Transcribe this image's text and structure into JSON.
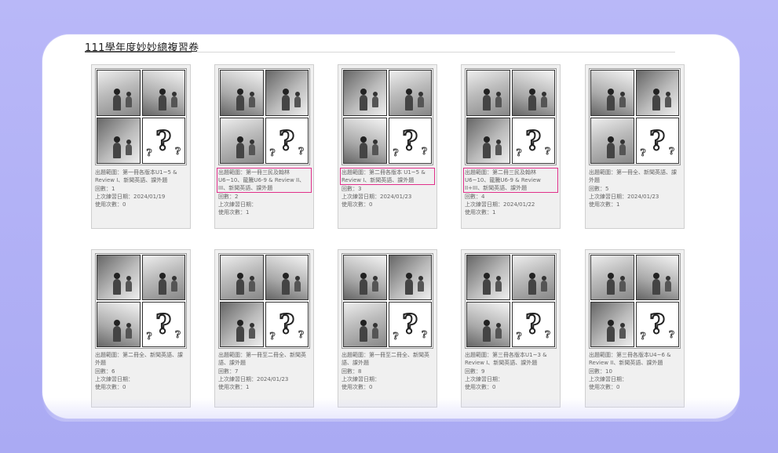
{
  "page": {
    "title": "111學年度妙妙總複習卷"
  },
  "labels": {
    "range": "出題範圍：",
    "count": "回數：",
    "last": "上次練習日期：",
    "uses": "使用次數："
  },
  "cards": [
    {
      "range": "第一冊各版本U1~5 & Review I、新聞英語、課外題",
      "count": "1",
      "last": "2024/01/19",
      "uses": "0",
      "highlighted": false
    },
    {
      "range": "第一冊三民及翰林U6~10、龍騰U6-9 & Review II、III、新聞英語、課外題",
      "count": "2",
      "last": "",
      "uses": "1",
      "highlighted": true
    },
    {
      "range": "第二冊各版本 U1~5 & Review I、新聞英語、課外題",
      "count": "3",
      "last": "2024/01/23",
      "uses": "0",
      "highlighted": true
    },
    {
      "range": "第二冊三民及翰林U6~10、龍騰U6-9 & Review II+III、新聞英語、課外題",
      "count": "4",
      "last": "2024/01/22",
      "uses": "1",
      "highlighted": true
    },
    {
      "range": "第一冊全、新聞英語、課外題",
      "count": "5",
      "last": "2024/01/23",
      "uses": "1",
      "highlighted": false
    },
    {
      "range": "第二冊全、新聞英語、課外題",
      "count": "6",
      "last": "",
      "uses": "0",
      "highlighted": false
    },
    {
      "range": "第一冊至二冊全、新聞英語、課外題",
      "count": "7",
      "last": "2024/01/23",
      "uses": "1",
      "highlighted": false
    },
    {
      "range": "第一冊至二冊全、新聞英語、課外題",
      "count": "8",
      "last": "",
      "uses": "0",
      "highlighted": false
    },
    {
      "range": "第三冊各版本U1~3 & Review I、新聞英語、課外題",
      "count": "9",
      "last": "",
      "uses": "0",
      "highlighted": false
    },
    {
      "range": "第三冊各版本U4~6 & Review II、新聞英語、課外題",
      "count": "10",
      "last": "",
      "uses": "0",
      "highlighted": false
    }
  ],
  "colors": {
    "background": "#b3b3f6",
    "panel": "#ffffff",
    "highlight": "#e0308a"
  },
  "icons": {
    "thumbnail": "comic-strip-icon",
    "mystery": "question-mark-icon"
  }
}
